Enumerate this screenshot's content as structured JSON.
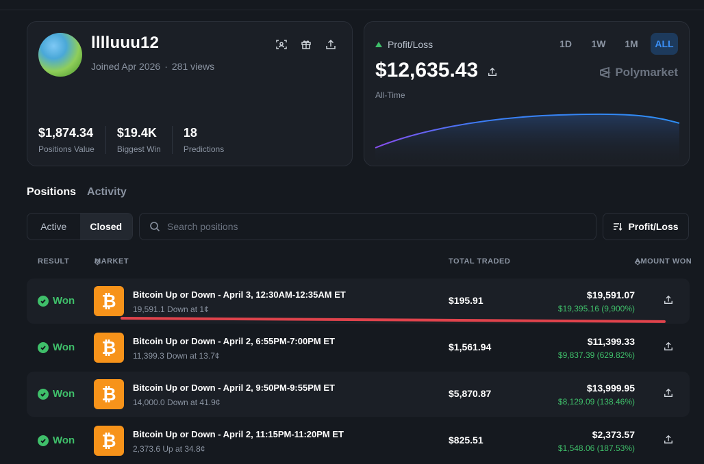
{
  "profile": {
    "username": "lllluuu12",
    "joined": "Joined Apr 2026",
    "views": "281 views",
    "stats": [
      {
        "value": "$1,874.34",
        "label": "Positions Value"
      },
      {
        "value": "$19.4K",
        "label": "Biggest Win"
      },
      {
        "value": "18",
        "label": "Predictions"
      }
    ]
  },
  "pnl": {
    "label": "Profit/Loss",
    "value": "$12,635.43",
    "period": "All-Time",
    "brand": "Polymarket",
    "ranges": [
      "1D",
      "1W",
      "1M",
      "ALL"
    ],
    "active_range": "ALL"
  },
  "tabs": {
    "positions": "Positions",
    "activity": "Activity"
  },
  "filter": {
    "active": "Active",
    "closed": "Closed"
  },
  "search": {
    "placeholder": "Search positions"
  },
  "sort": {
    "label": "Profit/Loss"
  },
  "table": {
    "headers": {
      "result": "RESULT",
      "market": "MARKET",
      "total_traded": "TOTAL TRADED",
      "amount_won": "AMOUNT WON"
    },
    "rows": [
      {
        "result": "Won",
        "title": "Bitcoin Up or Down - April 3, 12:30AM-12:35AM ET",
        "sub": "19,591.1 Down at 1¢",
        "traded": "$195.91",
        "won": "$19,591.07",
        "gain": "$19,395.16 (9,900%)"
      },
      {
        "result": "Won",
        "title": "Bitcoin Up or Down - April 2, 6:55PM-7:00PM ET",
        "sub": "11,399.3 Down at 13.7¢",
        "traded": "$1,561.94",
        "won": "$11,399.33",
        "gain": "$9,837.39 (629.82%)"
      },
      {
        "result": "Won",
        "title": "Bitcoin Up or Down - April 2, 9:50PM-9:55PM ET",
        "sub": "14,000.0 Down at 41.9¢",
        "traded": "$5,870.87",
        "won": "$13,999.95",
        "gain": "$8,129.09 (138.46%)"
      },
      {
        "result": "Won",
        "title": "Bitcoin Up or Down - April 2, 11:15PM-11:20PM ET",
        "sub": "2,373.6 Up at 34.8¢",
        "traded": "$825.51",
        "won": "$2,373.57",
        "gain": "$1,548.06 (187.53%)"
      }
    ]
  },
  "colors": {
    "accent": "#3b8ff5",
    "positive": "#3fbf6a",
    "btc": "#f7931a",
    "annotation": "#e0434c"
  }
}
